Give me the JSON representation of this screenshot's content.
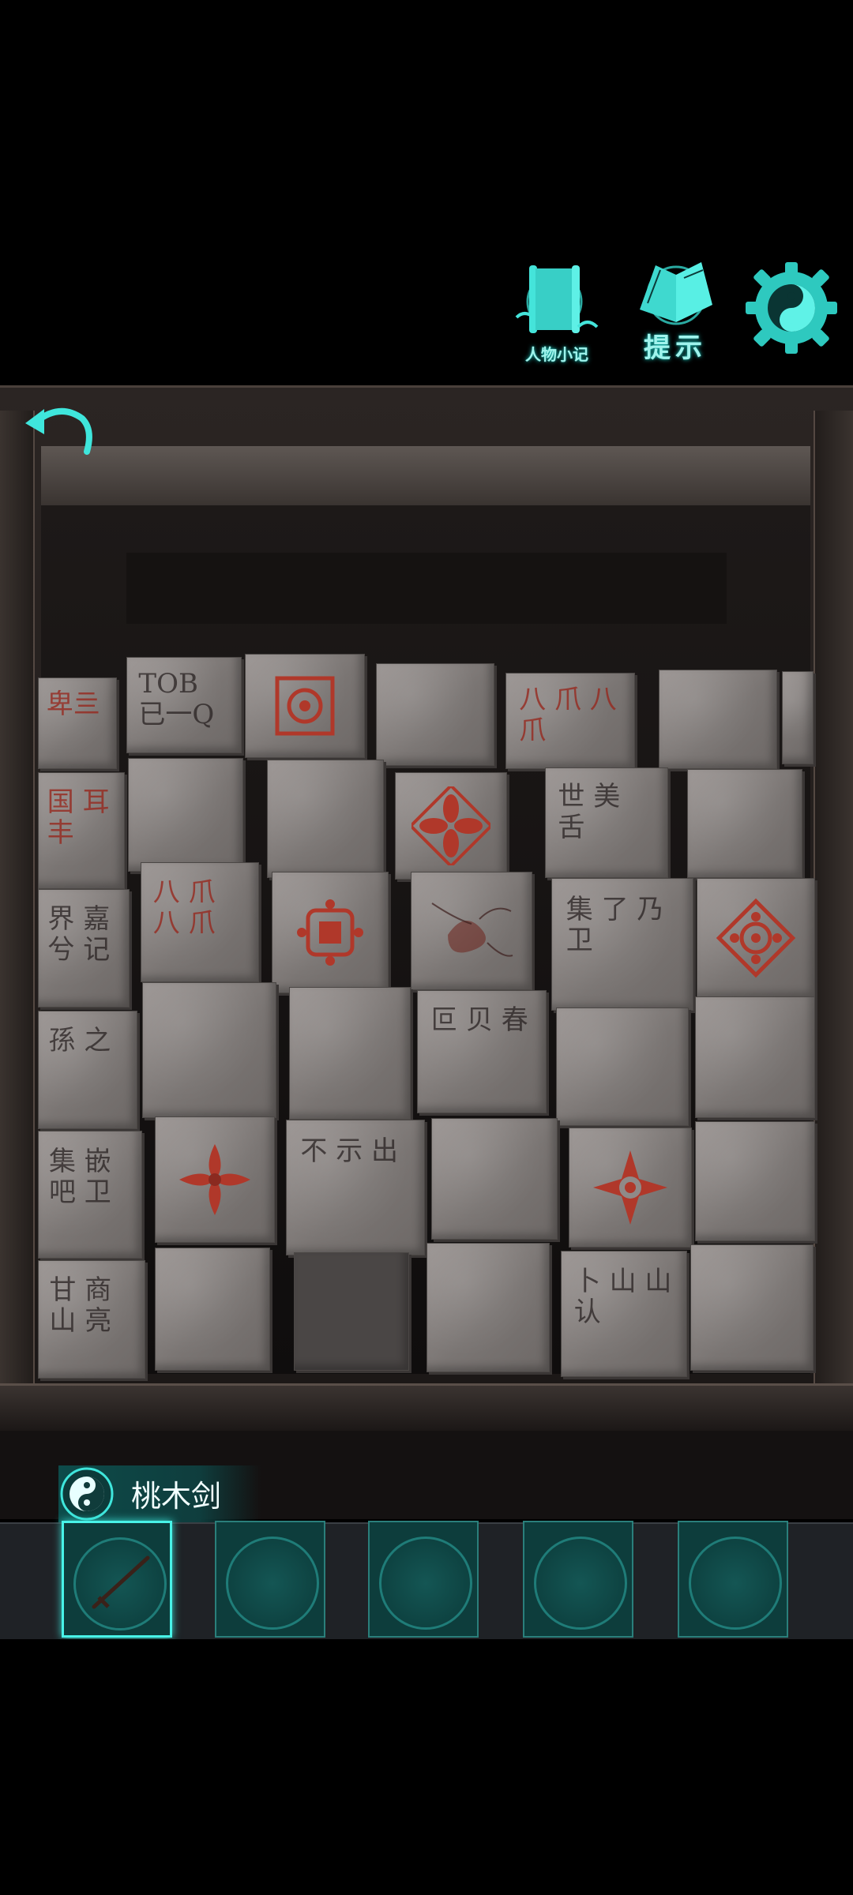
{
  "toolbar": {
    "character_notes_label": "人物小记",
    "hint_label": "提示",
    "settings_icon": "yin-yang-gear-icon",
    "accent_color": "#3fe6dc"
  },
  "cabinet": {
    "blocks": [
      {
        "text": "TOB 已一Q"
      },
      {
        "text": "卑亖"
      },
      {
        "text": "国 耳 丰"
      },
      {
        "text": "界 嘉 兮 记"
      },
      {
        "text": "八 爪 八 爪"
      },
      {
        "text": "八 爪 八 爪"
      },
      {
        "text": "世 美 舌"
      },
      {
        "text": "集 了 乃 卫"
      },
      {
        "text": "孫 之"
      },
      {
        "text": "叵 贝 春"
      },
      {
        "text": "集 嵌 吧 卫"
      },
      {
        "text": "不 示 出"
      },
      {
        "text": "甘 商 山 亮"
      },
      {
        "text": "卜 山 山 认"
      }
    ]
  },
  "inventory": {
    "selected_item_name": "桃木剑",
    "slots": 5,
    "selected_slot": 0
  }
}
